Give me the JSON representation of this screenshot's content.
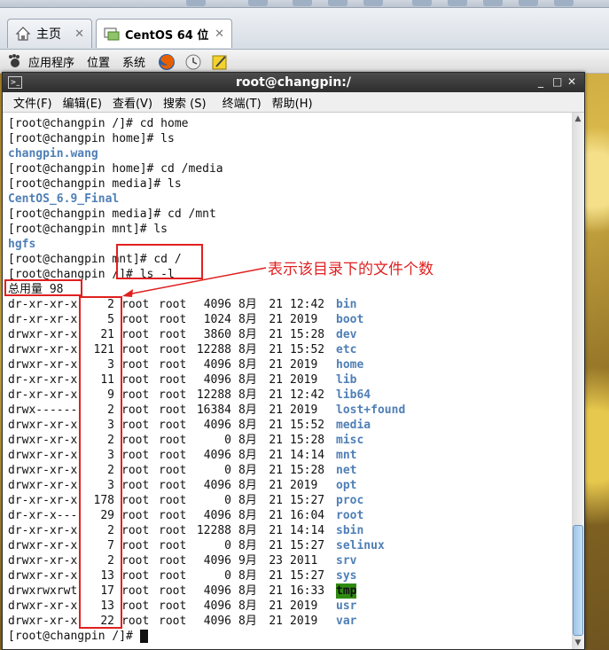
{
  "tabs": [
    {
      "label": "主页",
      "close": "✕"
    },
    {
      "label": "CentOS 64 位",
      "close": "✕"
    }
  ],
  "panel": {
    "apps": "应用程序",
    "places": "位置",
    "system": "系统"
  },
  "window": {
    "title": "root@changpin:/",
    "minimize": "_",
    "maximize": "□",
    "close": "✕"
  },
  "menu": [
    "文件(F)",
    "编辑(E)",
    "查看(V)",
    "搜索 (S)",
    "终端(T)",
    "帮助(H)"
  ],
  "history": [
    {
      "text": "[root@changpin /]# cd home",
      "style": "prompt"
    },
    {
      "text": "[root@changpin home]# ls",
      "style": "prompt"
    },
    {
      "text": "changpin.wang",
      "style": "blue"
    },
    {
      "text": "[root@changpin home]# cd /media",
      "style": "prompt"
    },
    {
      "text": "[root@changpin media]# ls",
      "style": "prompt"
    },
    {
      "text": "CentOS_6.9_Final",
      "style": "blue"
    },
    {
      "text": "[root@changpin media]# cd /mnt",
      "style": "prompt"
    },
    {
      "text": "[root@changpin mnt]# ls",
      "style": "prompt"
    },
    {
      "text": "hgfs",
      "style": "blue"
    },
    {
      "text": "[root@changpin mnt]# cd /",
      "style": "prompt"
    },
    {
      "text": "[root@changpin /]# ls -l",
      "style": "prompt"
    },
    {
      "text": "总用量 98",
      "style": "plain"
    }
  ],
  "listing": [
    {
      "perm": "dr-xr-xr-x",
      "links": "2",
      "owner": "root",
      "group": "root",
      "size": "4096",
      "month": "8月",
      "day": "21",
      "time": "12:42",
      "name": "bin"
    },
    {
      "perm": "dr-xr-xr-x",
      "links": "5",
      "owner": "root",
      "group": "root",
      "size": "1024",
      "month": "8月",
      "day": "21",
      "time": "2019",
      "name": "boot"
    },
    {
      "perm": "drwxr-xr-x",
      "links": "21",
      "owner": "root",
      "group": "root",
      "size": "3860",
      "month": "8月",
      "day": "21",
      "time": "15:28",
      "name": "dev"
    },
    {
      "perm": "drwxr-xr-x",
      "links": "121",
      "owner": "root",
      "group": "root",
      "size": "12288",
      "month": "8月",
      "day": "21",
      "time": "15:52",
      "name": "etc"
    },
    {
      "perm": "drwxr-xr-x",
      "links": "3",
      "owner": "root",
      "group": "root",
      "size": "4096",
      "month": "8月",
      "day": "21",
      "time": "2019",
      "name": "home"
    },
    {
      "perm": "dr-xr-xr-x",
      "links": "11",
      "owner": "root",
      "group": "root",
      "size": "4096",
      "month": "8月",
      "day": "21",
      "time": "2019",
      "name": "lib"
    },
    {
      "perm": "dr-xr-xr-x",
      "links": "9",
      "owner": "root",
      "group": "root",
      "size": "12288",
      "month": "8月",
      "day": "21",
      "time": "12:42",
      "name": "lib64"
    },
    {
      "perm": "drwx------",
      "links": "2",
      "owner": "root",
      "group": "root",
      "size": "16384",
      "month": "8月",
      "day": "21",
      "time": "2019",
      "name": "lost+found"
    },
    {
      "perm": "drwxr-xr-x",
      "links": "3",
      "owner": "root",
      "group": "root",
      "size": "4096",
      "month": "8月",
      "day": "21",
      "time": "15:52",
      "name": "media"
    },
    {
      "perm": "drwxr-xr-x",
      "links": "2",
      "owner": "root",
      "group": "root",
      "size": "0",
      "month": "8月",
      "day": "21",
      "time": "15:28",
      "name": "misc"
    },
    {
      "perm": "drwxr-xr-x",
      "links": "3",
      "owner": "root",
      "group": "root",
      "size": "4096",
      "month": "8月",
      "day": "21",
      "time": "14:14",
      "name": "mnt"
    },
    {
      "perm": "drwxr-xr-x",
      "links": "2",
      "owner": "root",
      "group": "root",
      "size": "0",
      "month": "8月",
      "day": "21",
      "time": "15:28",
      "name": "net"
    },
    {
      "perm": "drwxr-xr-x",
      "links": "3",
      "owner": "root",
      "group": "root",
      "size": "4096",
      "month": "8月",
      "day": "21",
      "time": "2019",
      "name": "opt"
    },
    {
      "perm": "dr-xr-xr-x",
      "links": "178",
      "owner": "root",
      "group": "root",
      "size": "0",
      "month": "8月",
      "day": "21",
      "time": "15:27",
      "name": "proc"
    },
    {
      "perm": "dr-xr-x---",
      "links": "29",
      "owner": "root",
      "group": "root",
      "size": "4096",
      "month": "8月",
      "day": "21",
      "time": "16:04",
      "name": "root"
    },
    {
      "perm": "dr-xr-xr-x",
      "links": "2",
      "owner": "root",
      "group": "root",
      "size": "12288",
      "month": "8月",
      "day": "21",
      "time": "14:14",
      "name": "sbin"
    },
    {
      "perm": "drwxr-xr-x",
      "links": "7",
      "owner": "root",
      "group": "root",
      "size": "0",
      "month": "8月",
      "day": "21",
      "time": "15:27",
      "name": "selinux"
    },
    {
      "perm": "drwxr-xr-x",
      "links": "2",
      "owner": "root",
      "group": "root",
      "size": "4096",
      "month": "9月",
      "day": "23",
      "time": "2011",
      "name": "srv"
    },
    {
      "perm": "drwxr-xr-x",
      "links": "13",
      "owner": "root",
      "group": "root",
      "size": "0",
      "month": "8月",
      "day": "21",
      "time": "15:27",
      "name": "sys"
    },
    {
      "perm": "drwxrwxrwt",
      "links": "17",
      "owner": "root",
      "group": "root",
      "size": "4096",
      "month": "8月",
      "day": "21",
      "time": "16:33",
      "name": "tmp"
    },
    {
      "perm": "drwxr-xr-x",
      "links": "13",
      "owner": "root",
      "group": "root",
      "size": "4096",
      "month": "8月",
      "day": "21",
      "time": "2019",
      "name": "usr"
    },
    {
      "perm": "drwxr-xr-x",
      "links": "22",
      "owner": "root",
      "group": "root",
      "size": "4096",
      "month": "8月",
      "day": "21",
      "time": "2019",
      "name": "var"
    }
  ],
  "final_prompt": "[root@changpin /]# ",
  "annotation": "表示该目录下的文件个数",
  "colors": {
    "directory": "#4f7fb6",
    "sticky_bg": "#2e8b10",
    "annotation": "#e02020"
  }
}
